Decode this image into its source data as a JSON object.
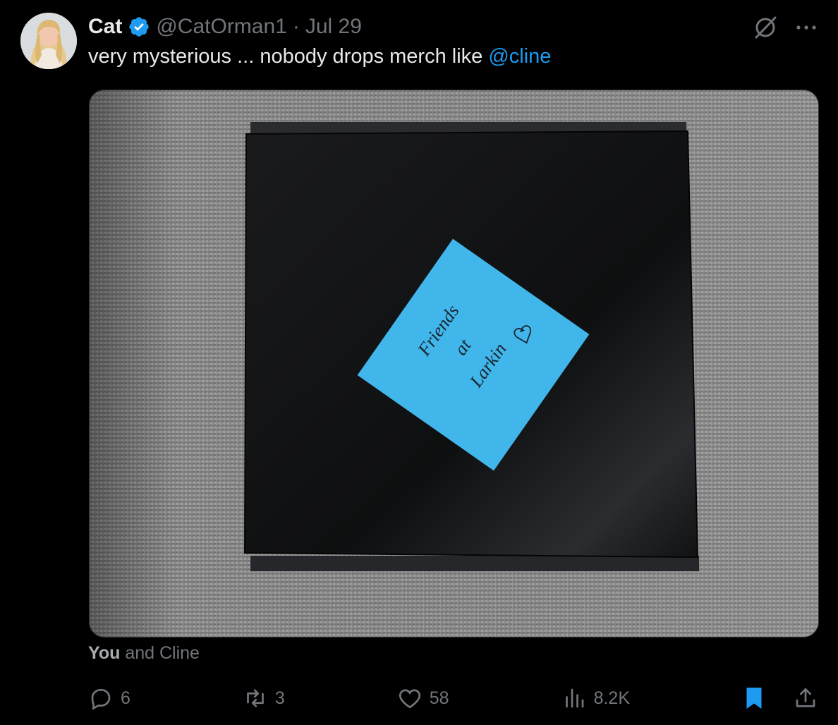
{
  "author": {
    "display_name": "Cat",
    "handle": "@CatOrman1",
    "separator": "·",
    "date": "Jul 29"
  },
  "tweet": {
    "text_before": "very mysterious ... nobody drops merch like ",
    "mention": "@cline"
  },
  "media": {
    "sticky_note_lines": [
      "Friends",
      "at",
      "Larkin"
    ],
    "sticky_note_color": "#3fb5ea",
    "box_color": "#131416",
    "surface_color": "#8a8a8a"
  },
  "liked_by": {
    "bold": "You",
    "rest": " and Cline"
  },
  "actions": {
    "replies": "6",
    "reposts": "3",
    "likes": "58",
    "views": "8.2K"
  },
  "colors": {
    "accent": "#1d9bf0",
    "muted": "#71767b",
    "text": "#e7e9ea",
    "background": "#000000"
  },
  "icons": {
    "verified": "verified-badge-icon",
    "grok": "grok-icon",
    "more": "more-icon",
    "reply": "reply-icon",
    "repost": "repost-icon",
    "like": "heart-icon",
    "views": "views-icon",
    "bookmark": "bookmark-icon",
    "share": "share-icon"
  }
}
